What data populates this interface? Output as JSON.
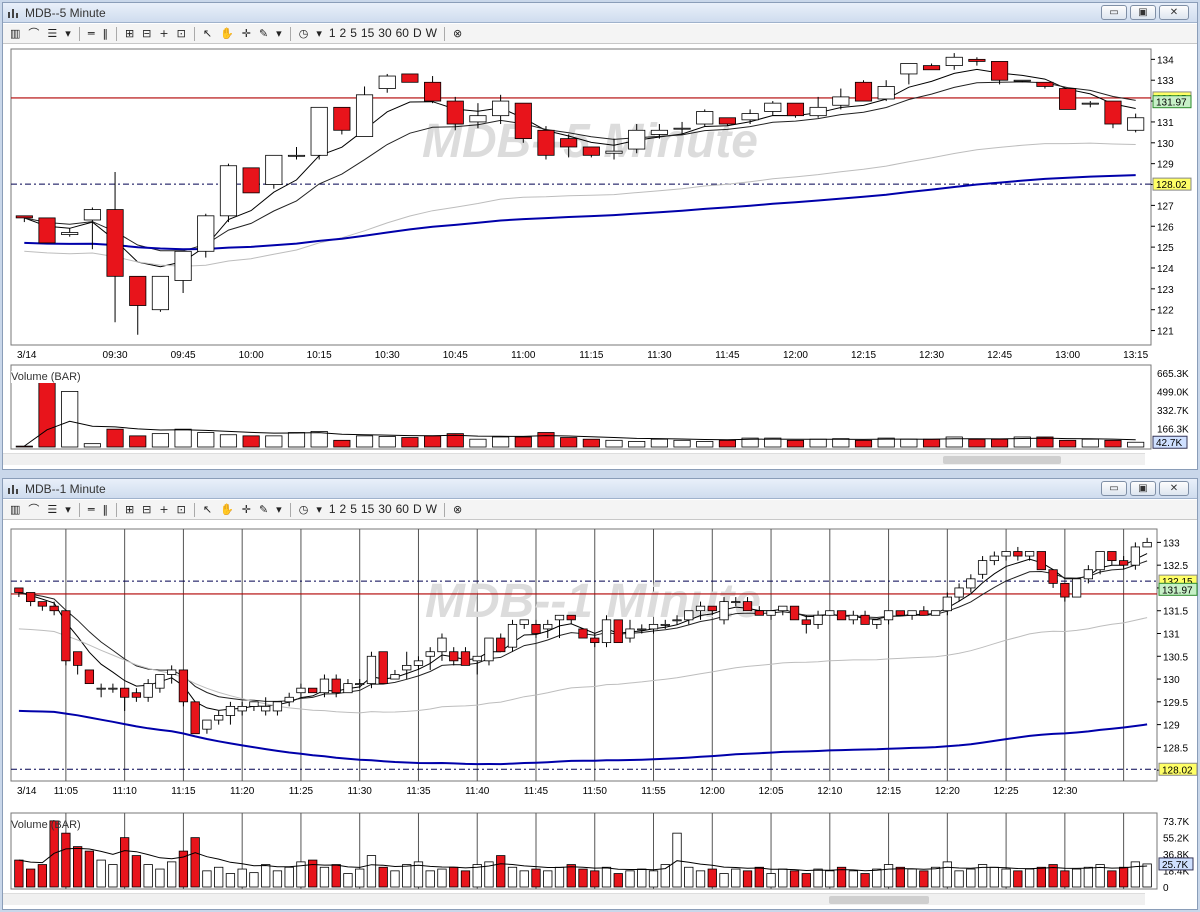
{
  "colors": {
    "up": "#ffffff",
    "down": "#e8141b",
    "avg_blue": "#0000aa",
    "avg_black": "#000000",
    "avg_gray": "#bdbdbd",
    "line_red": "#b00000",
    "dash": "#000050",
    "tag_green": "#c7f0c7",
    "tag_yellow": "#ffff66",
    "tag_blue": "#cfe0ff"
  },
  "toolbar": {
    "icons": [
      "bars-icon",
      "mountain-icon",
      "line-style-icon",
      "dropdown-icon",
      "hlines-icon",
      "vlines-icon",
      "zoom-in-icon",
      "zoom-out-icon",
      "crosshair-icon",
      "zoom-box-icon",
      "pointer-icon",
      "hand-icon",
      "cross-icon",
      "pen-icon",
      "dropdown-icon",
      "clock-icon",
      "dropdown-icon"
    ],
    "timeframes": [
      "1",
      "2",
      "5",
      "15",
      "30",
      "60",
      "D",
      "W"
    ],
    "cancel_icon": "cancel-icon"
  },
  "win1": {
    "title": "MDB--5 Minute",
    "watermark": "MDB--5 Minute",
    "date_label": "3/14",
    "volume_label": "Volume (BAR)",
    "price_ticks": [
      "134",
      "133",
      "132",
      "131",
      "130",
      "129",
      "128",
      "127",
      "126",
      "125",
      "124",
      "123",
      "122",
      "121"
    ],
    "time_ticks": [
      "09:30",
      "09:45",
      "10:00",
      "10:15",
      "10:30",
      "10:45",
      "11:00",
      "11:15",
      "11:30",
      "11:45",
      "12:00",
      "12:15",
      "12:30",
      "12:45",
      "13:00",
      "13:15"
    ],
    "volume_ticks": [
      "665.3K",
      "499.0K",
      "332.7K",
      "166.3K"
    ],
    "tag_last": "131.97",
    "tag_red": "132.15",
    "tag_dash": "128.02",
    "tag_vol": "42.7K"
  },
  "win2": {
    "title": "MDB--1 Minute",
    "watermark": "MDB--1 Minute",
    "date_label": "3/14",
    "volume_label": "Volume (BAR)",
    "price_ticks": [
      "133",
      "132.5",
      "132",
      "131.5",
      "131",
      "130.5",
      "130",
      "129.5",
      "129",
      "128.5",
      "128"
    ],
    "time_ticks": [
      "11:05",
      "11:10",
      "11:15",
      "11:20",
      "11:25",
      "11:30",
      "11:35",
      "11:40",
      "11:45",
      "11:50",
      "11:55",
      "12:00",
      "12:05",
      "12:10",
      "12:15",
      "12:20",
      "12:25",
      "12:30"
    ],
    "volume_ticks": [
      "73.7K",
      "55.2K",
      "36.8K",
      "18.4K",
      "0"
    ],
    "tag_last": "131.97",
    "tag_red": "132.15",
    "tag_dash": "128.02",
    "tag_vol": "25.7K"
  },
  "chart_data": [
    {
      "type": "candlestick",
      "title": "MDB--5 Minute",
      "ylim": [
        120.5,
        134.4
      ],
      "reference_lines": {
        "red_solid": 132.15,
        "dash_upper": 132.15,
        "dash_lower": 128.02,
        "last": 131.97
      },
      "candles": [
        [
          126.5,
          126.5,
          126.2,
          126.4
        ],
        [
          126.4,
          126.4,
          125.2,
          125.2
        ],
        [
          125.6,
          125.9,
          125.5,
          125.7
        ],
        [
          126.3,
          126.9,
          124.9,
          126.8
        ],
        [
          126.8,
          128.6,
          121.4,
          123.6
        ],
        [
          123.6,
          123.6,
          120.8,
          122.2
        ],
        [
          122.0,
          123.4,
          121.9,
          123.6
        ],
        [
          123.4,
          124.8,
          122.8,
          124.8
        ],
        [
          124.8,
          126.6,
          124.5,
          126.5
        ],
        [
          126.5,
          129.0,
          126.2,
          128.9
        ],
        [
          128.8,
          128.8,
          128.0,
          127.6
        ],
        [
          128.0,
          129.4,
          127.8,
          129.4
        ],
        [
          129.4,
          129.8,
          129.2,
          129.4
        ],
        [
          129.4,
          131.7,
          129.2,
          131.7
        ],
        [
          131.7,
          131.7,
          130.4,
          130.6
        ],
        [
          130.3,
          132.7,
          130.3,
          132.3
        ],
        [
          132.6,
          133.3,
          132.4,
          133.2
        ],
        [
          133.3,
          133.3,
          132.9,
          132.9
        ],
        [
          132.9,
          133.2,
          131.9,
          132.0
        ],
        [
          132.0,
          132.2,
          130.6,
          130.9
        ],
        [
          131.0,
          131.9,
          130.7,
          131.3
        ],
        [
          131.3,
          132.3,
          130.9,
          132.0
        ],
        [
          131.9,
          131.9,
          130.0,
          130.2
        ],
        [
          130.6,
          130.8,
          129.2,
          129.4
        ],
        [
          130.2,
          130.4,
          129.3,
          129.8
        ],
        [
          129.8,
          129.8,
          129.3,
          129.4
        ],
        [
          129.5,
          130.2,
          129.2,
          129.6
        ],
        [
          129.7,
          130.9,
          129.5,
          130.6
        ],
        [
          130.4,
          130.9,
          130.2,
          130.6
        ],
        [
          130.7,
          131.0,
          130.4,
          130.7
        ],
        [
          130.9,
          131.6,
          130.8,
          131.5
        ],
        [
          131.2,
          131.2,
          130.8,
          130.9
        ],
        [
          131.1,
          131.6,
          130.9,
          131.4
        ],
        [
          131.5,
          132.0,
          131.3,
          131.9
        ],
        [
          131.9,
          131.9,
          131.2,
          131.3
        ],
        [
          131.3,
          132.2,
          131.2,
          131.7
        ],
        [
          131.8,
          132.6,
          131.6,
          132.2
        ],
        [
          132.9,
          133.0,
          132.1,
          132.0
        ],
        [
          132.1,
          133.0,
          132.0,
          132.7
        ],
        [
          133.3,
          133.4,
          132.8,
          133.8
        ],
        [
          133.7,
          133.8,
          133.5,
          133.5
        ],
        [
          133.7,
          134.3,
          133.5,
          134.1
        ],
        [
          134.0,
          134.1,
          133.7,
          133.9
        ],
        [
          133.9,
          133.9,
          132.8,
          133.0
        ],
        [
          133.0,
          133.0,
          132.9,
          133.0
        ],
        [
          132.9,
          132.8,
          132.6,
          132.7
        ],
        [
          132.6,
          132.6,
          131.6,
          131.6
        ],
        [
          131.9,
          132.0,
          131.7,
          131.9
        ],
        [
          132.0,
          132.0,
          130.7,
          130.9
        ],
        [
          130.6,
          131.4,
          130.5,
          131.2
        ]
      ],
      "volume_k": [
        8,
        665,
        499,
        30,
        160,
        100,
        120,
        160,
        130,
        110,
        100,
        100,
        130,
        140,
        60,
        100,
        95,
        85,
        100,
        120,
        70,
        90,
        90,
        130,
        85,
        70,
        60,
        50,
        70,
        60,
        50,
        60,
        80,
        80,
        60,
        70,
        75,
        60,
        80,
        70,
        70,
        90,
        70,
        70,
        90,
        90,
        60,
        70,
        60,
        42.7
      ]
    },
    {
      "type": "candlestick",
      "title": "MDB--1 Minute",
      "ylim": [
        127.85,
        133.25
      ],
      "reference_lines": {
        "red_solid": 132.0,
        "dash_upper": 132.15,
        "dash_lower": 128.02,
        "last": 131.97
      },
      "candles": [
        [
          132.0,
          132.0,
          131.8,
          131.9
        ],
        [
          131.9,
          131.9,
          131.6,
          131.7
        ],
        [
          131.7,
          131.7,
          131.5,
          131.6
        ],
        [
          131.6,
          131.7,
          131.4,
          131.5
        ],
        [
          131.5,
          131.5,
          130.3,
          130.4
        ],
        [
          130.6,
          130.6,
          130.1,
          130.3
        ],
        [
          130.2,
          130.2,
          129.9,
          129.9
        ],
        [
          129.8,
          129.9,
          129.6,
          129.8
        ],
        [
          129.8,
          129.9,
          129.7,
          129.8
        ],
        [
          129.8,
          129.8,
          129.3,
          129.6
        ],
        [
          129.7,
          129.8,
          129.5,
          129.6
        ],
        [
          129.6,
          130.0,
          129.5,
          129.9
        ],
        [
          129.8,
          130.1,
          129.7,
          130.1
        ],
        [
          130.1,
          130.3,
          129.9,
          130.2
        ],
        [
          130.2,
          130.2,
          129.4,
          129.5
        ],
        [
          129.5,
          129.5,
          128.8,
          128.8
        ],
        [
          128.9,
          129.1,
          128.8,
          129.1
        ],
        [
          129.1,
          129.3,
          129.0,
          129.2
        ],
        [
          129.2,
          129.5,
          129.0,
          129.4
        ],
        [
          129.3,
          129.5,
          129.2,
          129.4
        ],
        [
          129.4,
          129.5,
          129.3,
          129.5
        ],
        [
          129.3,
          129.6,
          129.2,
          129.4
        ],
        [
          129.3,
          129.5,
          129.2,
          129.5
        ],
        [
          129.5,
          129.7,
          129.4,
          129.6
        ],
        [
          129.7,
          129.9,
          129.6,
          129.8
        ],
        [
          129.8,
          129.8,
          129.7,
          129.7
        ],
        [
          129.7,
          130.1,
          129.6,
          130.0
        ],
        [
          130.0,
          130.1,
          129.6,
          129.7
        ],
        [
          129.7,
          130.0,
          129.7,
          129.9
        ],
        [
          129.9,
          130.0,
          129.8,
          129.9
        ],
        [
          129.9,
          130.6,
          129.8,
          130.5
        ],
        [
          130.6,
          130.6,
          129.9,
          129.9
        ],
        [
          130.0,
          130.2,
          130.0,
          130.1
        ],
        [
          130.2,
          130.6,
          130.0,
          130.3
        ],
        [
          130.3,
          130.5,
          130.2,
          130.4
        ],
        [
          130.5,
          130.7,
          130.2,
          130.6
        ],
        [
          130.6,
          131.0,
          130.4,
          130.9
        ],
        [
          130.6,
          130.7,
          130.3,
          130.4
        ],
        [
          130.6,
          130.7,
          130.3,
          130.3
        ],
        [
          130.4,
          130.5,
          130.1,
          130.5
        ],
        [
          130.4,
          130.9,
          130.3,
          130.9
        ],
        [
          130.9,
          131.0,
          130.6,
          130.6
        ],
        [
          130.7,
          131.3,
          130.6,
          131.2
        ],
        [
          131.2,
          131.3,
          131.1,
          131.3
        ],
        [
          131.2,
          131.3,
          130.9,
          131.0
        ],
        [
          131.1,
          131.3,
          130.9,
          131.2
        ],
        [
          131.3,
          131.4,
          130.9,
          131.4
        ],
        [
          131.4,
          131.4,
          131.2,
          131.3
        ],
        [
          131.1,
          131.1,
          130.9,
          130.9
        ],
        [
          130.9,
          131.0,
          130.7,
          130.8
        ],
        [
          130.8,
          131.4,
          130.7,
          131.3
        ],
        [
          131.3,
          131.3,
          130.8,
          130.8
        ],
        [
          130.9,
          131.3,
          130.8,
          131.1
        ],
        [
          131.1,
          131.2,
          131.0,
          131.1
        ],
        [
          131.1,
          131.2,
          131.0,
          131.2
        ],
        [
          131.2,
          131.3,
          131.1,
          131.2
        ],
        [
          131.3,
          131.4,
          131.2,
          131.3
        ],
        [
          131.3,
          131.5,
          131.2,
          131.5
        ],
        [
          131.5,
          131.7,
          131.3,
          131.6
        ],
        [
          131.6,
          131.6,
          131.4,
          131.5
        ],
        [
          131.3,
          131.8,
          131.2,
          131.7
        ],
        [
          131.7,
          131.8,
          131.6,
          131.7
        ],
        [
          131.7,
          131.8,
          131.5,
          131.5
        ],
        [
          131.5,
          131.6,
          131.4,
          131.4
        ],
        [
          131.4,
          131.5,
          131.3,
          131.5
        ],
        [
          131.5,
          131.6,
          131.4,
          131.6
        ],
        [
          131.6,
          131.6,
          131.3,
          131.3
        ],
        [
          131.3,
          131.4,
          131.0,
          131.2
        ],
        [
          131.2,
          131.5,
          131.1,
          131.4
        ],
        [
          131.4,
          131.5,
          131.4,
          131.5
        ],
        [
          131.5,
          131.5,
          131.3,
          131.3
        ],
        [
          131.3,
          131.5,
          131.2,
          131.4
        ],
        [
          131.4,
          131.5,
          131.2,
          131.2
        ],
        [
          131.2,
          131.3,
          131.1,
          131.3
        ],
        [
          131.3,
          131.5,
          131.2,
          131.5
        ],
        [
          131.5,
          131.5,
          131.4,
          131.4
        ],
        [
          131.4,
          131.5,
          131.3,
          131.5
        ],
        [
          131.5,
          131.6,
          131.4,
          131.4
        ],
        [
          131.4,
          131.5,
          131.4,
          131.5
        ],
        [
          131.5,
          131.9,
          131.4,
          131.8
        ],
        [
          131.8,
          132.1,
          131.7,
          132.0
        ],
        [
          132.0,
          132.3,
          131.9,
          132.2
        ],
        [
          132.3,
          132.7,
          132.2,
          132.6
        ],
        [
          132.6,
          132.8,
          132.5,
          132.7
        ],
        [
          132.7,
          132.8,
          132.6,
          132.8
        ],
        [
          132.8,
          132.9,
          132.6,
          132.7
        ],
        [
          132.7,
          132.8,
          132.6,
          132.8
        ],
        [
          132.8,
          132.8,
          132.4,
          132.4
        ],
        [
          132.4,
          132.4,
          132.0,
          132.1
        ],
        [
          132.1,
          132.1,
          131.7,
          131.8
        ],
        [
          131.8,
          132.2,
          131.8,
          132.2
        ],
        [
          132.2,
          132.5,
          132.1,
          132.4
        ],
        [
          132.4,
          132.8,
          132.3,
          132.8
        ],
        [
          132.8,
          132.8,
          132.5,
          132.6
        ],
        [
          132.6,
          132.7,
          132.4,
          132.5
        ],
        [
          132.5,
          133.0,
          132.4,
          132.9
        ],
        [
          132.9,
          133.1,
          132.9,
          133.0
        ]
      ],
      "volume_k": [
        30,
        20,
        25,
        73.7,
        60,
        45,
        40,
        30,
        25,
        55,
        35,
        25,
        20,
        28,
        40,
        55,
        18,
        22,
        15,
        20,
        16,
        25,
        18,
        22,
        28,
        30,
        22,
        25,
        15,
        20,
        35,
        22,
        18,
        25,
        28,
        18,
        20,
        22,
        18,
        25,
        28,
        35,
        22,
        18,
        20,
        18,
        22,
        25,
        20,
        18,
        22,
        15,
        18,
        20,
        18,
        25,
        60,
        22,
        18,
        20,
        15,
        20,
        18,
        22,
        15,
        20,
        18,
        15,
        20,
        18,
        22,
        18,
        15,
        20,
        25,
        22,
        20,
        18,
        22,
        28,
        18,
        20,
        25,
        22,
        20,
        18,
        20,
        22,
        25,
        18,
        20,
        22,
        25,
        18,
        22,
        28,
        25.7
      ]
    }
  ]
}
